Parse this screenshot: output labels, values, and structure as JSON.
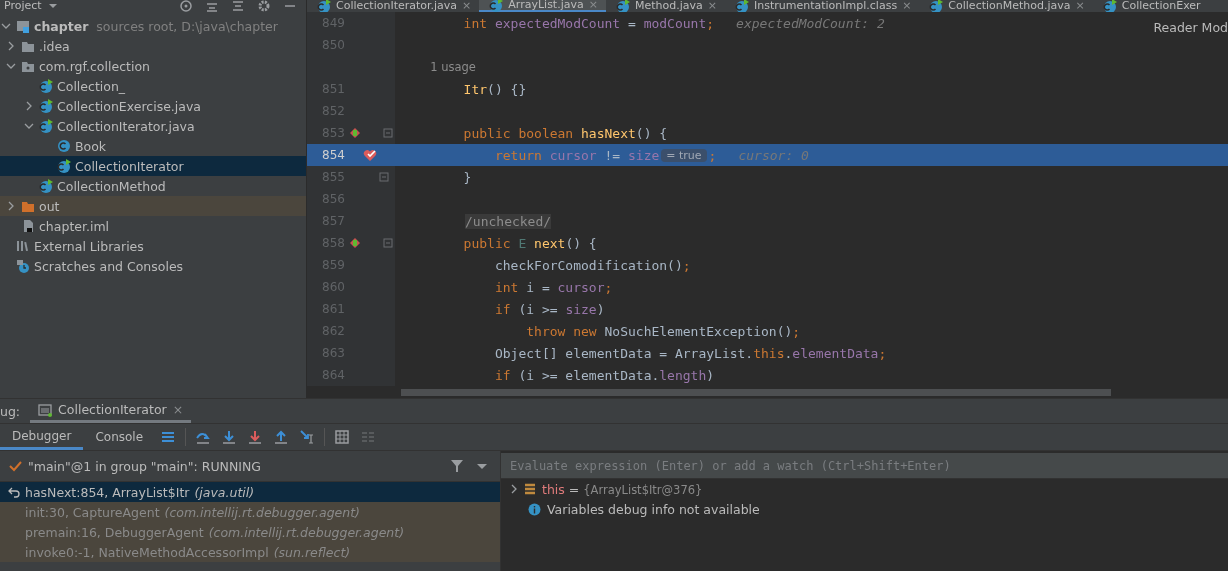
{
  "project_panel": {
    "title": "Project",
    "tree": [
      {
        "kind": "module",
        "name": "chapter",
        "detail": "sources root,  D:\\java\\chapter",
        "expanded": true,
        "selected": false,
        "children": [
          {
            "kind": "folder",
            "name": ".idea",
            "expanded": false,
            "selected": false
          },
          {
            "kind": "package",
            "name": "com.rgf.collection",
            "expanded": true,
            "selected": false,
            "children": [
              {
                "kind": "run-class",
                "name": "Collection_",
                "selected": false
              },
              {
                "kind": "run-class",
                "name": "CollectionExercise.java",
                "expanded": false,
                "selected": false
              },
              {
                "kind": "run-class",
                "name": "CollectionIterator.java",
                "expanded": true,
                "selected": false,
                "children": [
                  {
                    "kind": "class",
                    "name": "Book",
                    "selected": false
                  },
                  {
                    "kind": "run-class",
                    "name": "CollectionIterator",
                    "selected": true
                  }
                ]
              },
              {
                "kind": "run-class",
                "name": "CollectionMethod",
                "selected": false
              }
            ]
          },
          {
            "kind": "excluded-folder",
            "name": "out",
            "expanded": false,
            "selected": false
          },
          {
            "kind": "file",
            "name": "chapter.iml",
            "selected": false
          }
        ]
      },
      {
        "kind": "libraries",
        "name": "External Libraries",
        "selected": false
      },
      {
        "kind": "scratches",
        "name": "Scratches and Consoles",
        "selected": false
      }
    ]
  },
  "editor": {
    "tabs": [
      {
        "label": "CollectionIterator.java",
        "selected": false,
        "close": "×"
      },
      {
        "label": "ArrayList.java",
        "selected": true,
        "close": "×"
      },
      {
        "label": "Method.java",
        "selected": false,
        "close": "×"
      },
      {
        "label": "InstrumentationImpl.class",
        "selected": false,
        "close": "×"
      },
      {
        "label": "CollectionMethod.java",
        "selected": false,
        "close": "×"
      },
      {
        "label": "CollectionExer",
        "selected": false
      }
    ],
    "reader_mode": "Reader Mod",
    "lines": [
      {
        "number": "849",
        "tokens": [
          {
            "kind": "keyword",
            "text": "        int "
          },
          {
            "kind": "field",
            "text": "expectedModCount"
          },
          {
            "kind": "plain",
            "text": " = "
          },
          {
            "kind": "field",
            "text": "modCount"
          },
          {
            "kind": "keyword",
            "text": ";"
          },
          {
            "kind": "hint",
            "text": "expectedModCount: 2"
          }
        ]
      },
      {
        "number": "850"
      },
      {
        "tokens": [
          {
            "kind": "usage",
            "text": "        1 usage"
          }
        ]
      },
      {
        "number": "851",
        "tokens": [
          {
            "kind": "method",
            "text": "        Itr"
          },
          {
            "kind": "plain",
            "text": "() {}"
          }
        ]
      },
      {
        "number": "852"
      },
      {
        "number": "853",
        "method_breakpoint": true,
        "fold": true,
        "tokens": [
          {
            "kind": "keyword",
            "text": "        public boolean "
          },
          {
            "kind": "method",
            "text": "hasNext"
          },
          {
            "kind": "plain",
            "text": "() {"
          }
        ]
      },
      {
        "number": "854",
        "breakpoint": true,
        "current": true,
        "tokens": [
          {
            "kind": "keyword",
            "text": "            return "
          },
          {
            "kind": "field",
            "text": "cursor"
          },
          {
            "kind": "plain",
            "text": " != "
          },
          {
            "kind": "field",
            "text": "size"
          },
          {
            "kind": "inlay",
            "text": "= true"
          },
          {
            "kind": "keyword",
            "text": ";"
          },
          {
            "kind": "hint",
            "text": "cursor: 0"
          }
        ]
      },
      {
        "number": "855",
        "fold": true,
        "tokens": [
          {
            "kind": "plain",
            "text": "        }"
          }
        ]
      },
      {
        "number": "856"
      },
      {
        "number": "857",
        "tokens": [
          {
            "kind": "boxed",
            "text": "/unchecked/"
          }
        ]
      },
      {
        "number": "858",
        "method_breakpoint": true,
        "fold": true,
        "tokens": [
          {
            "kind": "keyword",
            "text": "        public "
          },
          {
            "kind": "type",
            "text": "E "
          },
          {
            "kind": "method",
            "text": "next"
          },
          {
            "kind": "plain",
            "text": "() {"
          }
        ]
      },
      {
        "number": "859",
        "tokens": [
          {
            "kind": "plain",
            "text": "            checkForComodification()"
          },
          {
            "kind": "keyword",
            "text": ";"
          }
        ]
      },
      {
        "number": "860",
        "tokens": [
          {
            "kind": "keyword",
            "text": "            int "
          },
          {
            "kind": "plain",
            "text": "i = "
          },
          {
            "kind": "field",
            "text": "cursor"
          },
          {
            "kind": "keyword",
            "text": ";"
          }
        ]
      },
      {
        "number": "861",
        "tokens": [
          {
            "kind": "keyword",
            "text": "            if "
          },
          {
            "kind": "plain",
            "text": "(i >= "
          },
          {
            "kind": "field",
            "text": "size"
          },
          {
            "kind": "plain",
            "text": ")"
          }
        ]
      },
      {
        "number": "862",
        "tokens": [
          {
            "kind": "keyword",
            "text": "                throw new "
          },
          {
            "kind": "plain",
            "text": "NoSuchElementException()"
          },
          {
            "kind": "keyword",
            "text": ";"
          }
        ]
      },
      {
        "number": "863",
        "tokens": [
          {
            "kind": "plain",
            "text": "            Object[] elementData = ArrayList."
          },
          {
            "kind": "keyword",
            "text": "this"
          },
          {
            "kind": "plain",
            "text": "."
          },
          {
            "kind": "field",
            "text": "elementData"
          },
          {
            "kind": "keyword",
            "text": ";"
          }
        ]
      },
      {
        "number": "864",
        "tokens": [
          {
            "kind": "keyword",
            "text": "            if "
          },
          {
            "kind": "plain",
            "text": "(i >= elementData."
          },
          {
            "kind": "field",
            "text": "length"
          },
          {
            "kind": "plain",
            "text": ")"
          }
        ]
      }
    ]
  },
  "debug": {
    "label": "ug:",
    "session_tab": {
      "label": "CollectionIterator",
      "selected": true,
      "close": "×"
    },
    "tabs": [
      {
        "label": "Debugger",
        "selected": true
      },
      {
        "label": "Console",
        "selected": false
      }
    ],
    "toolbar": [
      {
        "kind": "layout",
        "disabled": false
      },
      {
        "kind": "step-over",
        "disabled": false
      },
      {
        "kind": "step-into",
        "disabled": false
      },
      {
        "kind": "force-step-into",
        "disabled": false
      },
      {
        "kind": "step-out",
        "disabled": false
      },
      {
        "kind": "run-to-cursor",
        "disabled": false
      },
      {
        "kind": "evaluate",
        "disabled": false
      },
      {
        "kind": "trace",
        "disabled": true
      }
    ],
    "thread": "\"main\"@1 in group \"main\": RUNNING",
    "frames": [
      {
        "method": "hasNext:854, ArrayList$Itr",
        "package": "(java.util)",
        "selected": true
      },
      {
        "method": "init:30, CaptureAgent",
        "package": "(com.intellij.rt.debugger.agent)",
        "selected": false
      },
      {
        "method": "premain:16, DebuggerAgent",
        "package": "(com.intellij.rt.debugger.agent)",
        "selected": false
      },
      {
        "method": "invoke0:-1, NativeMethodAccessorImpl",
        "package": "(sun.reflect)",
        "selected": false
      }
    ],
    "evaluate": {
      "placeholder": "Evaluate expression (Enter) or add a watch (Ctrl+Shift+Enter)"
    },
    "variables": [
      {
        "kind": "object",
        "name": "this",
        "operator": "=",
        "value": "{ArrayList$Itr@376}",
        "expanded": false
      },
      {
        "kind": "info",
        "text": "Variables debug info not available"
      }
    ]
  }
}
